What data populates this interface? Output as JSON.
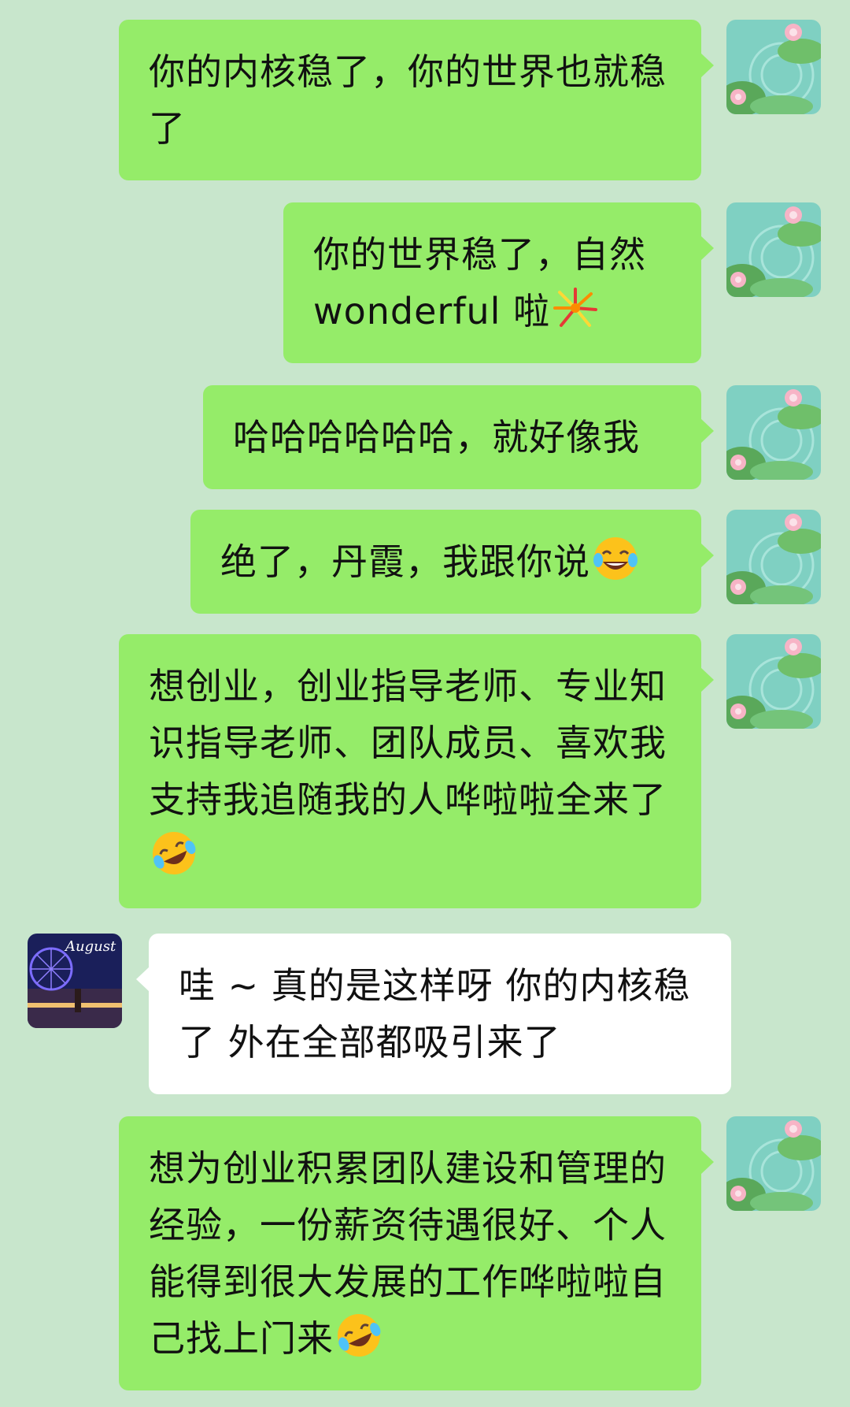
{
  "chat": {
    "messages": [
      {
        "sender": "me",
        "text": "你的内核稳了，你的世界也就稳了",
        "emoji": ""
      },
      {
        "sender": "me",
        "text": "你的世界稳了，自然wonderful 啦",
        "emoji": "fireworks-emoji"
      },
      {
        "sender": "me",
        "text": "哈哈哈哈哈哈，就好像我",
        "emoji": ""
      },
      {
        "sender": "me",
        "text": "绝了，丹霞，我跟你说",
        "emoji": "tears-of-joy-emoji"
      },
      {
        "sender": "me",
        "text": "想创业，创业指导老师、专业知识指导老师、团队成员、喜欢我支持我追随我的人哗啦啦全来了",
        "emoji": "rolling-laughing-emoji"
      },
      {
        "sender": "other",
        "text": "哇 ~ 真的是这样呀 你的内核稳了 外在全部都吸引来了",
        "emoji": ""
      },
      {
        "sender": "me",
        "text": "想为创业积累团队建设和管理的经验，一份薪资待遇很好、个人能得到很大发展的工作哗啦啦自己找上门来",
        "emoji": "rolling-laughing-emoji"
      }
    ],
    "avatars": {
      "me": "lotus-pond-avatar",
      "other": "ferris-wheel-avatar",
      "other_caption": "August"
    },
    "colors": {
      "background": "#c8e6cc",
      "my_bubble": "#95ec69",
      "their_bubble": "#ffffff"
    }
  }
}
